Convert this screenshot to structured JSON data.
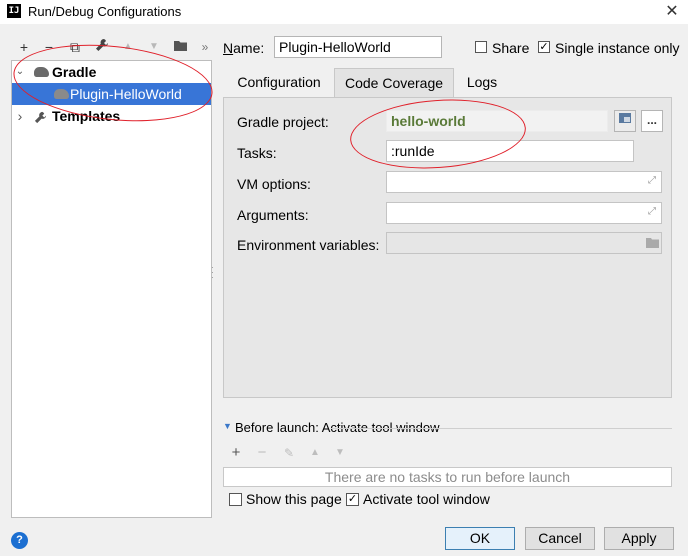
{
  "window": {
    "title": "Run/Debug Configurations",
    "app_icon_text": "IJ",
    "close_glyph": "✕"
  },
  "left_toolbar": [
    {
      "icon": "add-icon",
      "glyph": "+",
      "dim": false
    },
    {
      "icon": "remove-icon",
      "glyph": "−",
      "dim": false
    },
    {
      "icon": "copy-icon",
      "glyph": "⧉",
      "dim": false
    },
    {
      "icon": "wrench-icon",
      "glyph": "🔧",
      "dim": false
    },
    {
      "icon": "move-up-icon",
      "glyph": "▲",
      "dim": true
    },
    {
      "icon": "move-down-icon",
      "glyph": "▼",
      "dim": true
    },
    {
      "icon": "folder-icon",
      "glyph": "▬",
      "dim": false
    },
    {
      "icon": "more-icon",
      "glyph": "»",
      "dim": false
    }
  ],
  "tree": {
    "gradle": {
      "label": "Gradle",
      "expander": "⌄"
    },
    "plugin": {
      "label": "Plugin-HelloWorld"
    },
    "templates": {
      "label": "Templates",
      "expander": "›"
    }
  },
  "header": {
    "name_label": "Name:",
    "name_value": "Plugin-HelloWorld",
    "share_label": "Share",
    "share_checked": false,
    "single_instance_label": "Single instance only",
    "single_instance_checked": true
  },
  "tabs": [
    {
      "label": "Configuration",
      "active": false
    },
    {
      "label": "Code Coverage",
      "active": true
    },
    {
      "label": "Logs",
      "active": false
    }
  ],
  "form": {
    "gradle_project_label": "Gradle project:",
    "gradle_project_value": "hello-world",
    "browse_label": "...",
    "tasks_label": "Tasks:",
    "tasks_value": ":runIde",
    "vm_options_label": "VM options:",
    "vm_options_value": "",
    "arguments_label": "Arguments:",
    "arguments_value": "",
    "env_vars_label": "Environment variables:",
    "env_vars_value": ""
  },
  "before_launch": {
    "title": "Before launch: Activate tool window",
    "empty_text": "There are no tasks to run before launch",
    "show_page_label": "Show this page",
    "show_page_checked": false,
    "activate_tool_window_label": "Activate tool window",
    "activate_tool_window_checked": true
  },
  "buttons": {
    "ok": "OK",
    "cancel": "Cancel",
    "apply": "Apply"
  },
  "help_glyph": "?",
  "check_glyph": "✓"
}
